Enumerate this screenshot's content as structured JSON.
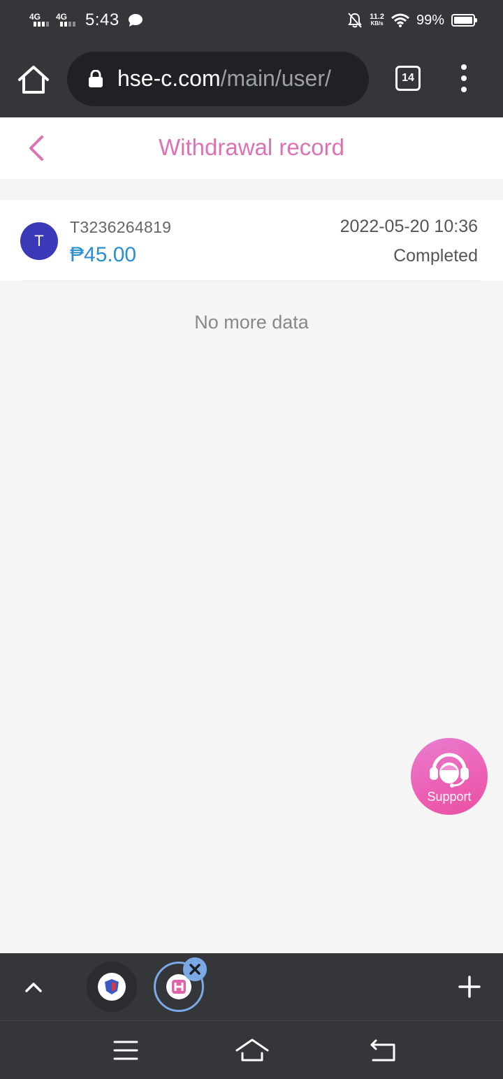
{
  "status_bar": {
    "network_1": "4G",
    "network_2": "4G",
    "time": "5:43",
    "speed_value": "11.2",
    "speed_unit": "KB/s",
    "battery": "99%"
  },
  "browser": {
    "url_domain": "hse-c.com",
    "url_path": "/main/user/",
    "tab_count": "14"
  },
  "page": {
    "title": "Withdrawal record",
    "records": [
      {
        "avatar_letter": "T",
        "id": "T3236264819",
        "amount": "₱45.00",
        "datetime": "2022-05-20 10:36",
        "status": "Completed"
      }
    ],
    "no_more_text": "No more data",
    "support_label": "Support",
    "accent_color": "#dc72b5",
    "amount_color": "#2a8fd0"
  },
  "icons": {
    "home": "home-icon",
    "lock": "lock-icon",
    "more": "more-vert-icon",
    "back": "chevron-left-icon",
    "support": "headset-icon",
    "up": "chevron-up-icon",
    "close": "close-icon",
    "add": "plus-icon"
  }
}
